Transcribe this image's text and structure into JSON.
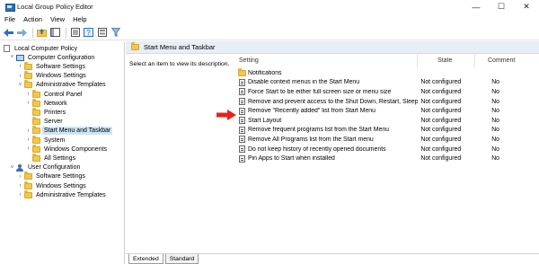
{
  "window": {
    "title": "Local Group Policy Editor",
    "controls": [
      "—",
      "☐",
      "✕"
    ]
  },
  "menu": [
    "File",
    "Action",
    "View",
    "Help"
  ],
  "toolbar": [
    "back-icon",
    "forward-icon",
    "up-folder-icon",
    "show-hide-tree-icon",
    "export-list-icon",
    "help-icon",
    "properties-icon",
    "filter-icon"
  ],
  "tree": [
    {
      "label": "Local Computer Policy",
      "icon": "doc",
      "indent": 0,
      "exp": ""
    },
    {
      "label": "Computer Configuration",
      "icon": "computer",
      "indent": 1,
      "exp": "v"
    },
    {
      "label": "Software Settings",
      "icon": "folder",
      "indent": 2,
      "exp": ">"
    },
    {
      "label": "Windows Settings",
      "icon": "folder",
      "indent": 2,
      "exp": ">"
    },
    {
      "label": "Administrative Templates",
      "icon": "folder",
      "indent": 2,
      "exp": "v"
    },
    {
      "label": "Control Panel",
      "icon": "folder",
      "indent": 3,
      "exp": ">"
    },
    {
      "label": "Network",
      "icon": "folder",
      "indent": 3,
      "exp": ">"
    },
    {
      "label": "Printers",
      "icon": "folder",
      "indent": 3,
      "exp": ""
    },
    {
      "label": "Server",
      "icon": "folder",
      "indent": 3,
      "exp": ""
    },
    {
      "label": "Start Menu and Taskbar",
      "icon": "folder",
      "indent": 3,
      "exp": ">",
      "selected": true
    },
    {
      "label": "System",
      "icon": "folder",
      "indent": 3,
      "exp": ">"
    },
    {
      "label": "Windows Components",
      "icon": "folder",
      "indent": 3,
      "exp": ">"
    },
    {
      "label": "All Settings",
      "icon": "folder",
      "indent": 3,
      "exp": ""
    },
    {
      "label": "User Configuration",
      "icon": "user",
      "indent": 1,
      "exp": "v"
    },
    {
      "label": "Software Settings",
      "icon": "folder",
      "indent": 2,
      "exp": ">"
    },
    {
      "label": "Windows Settings",
      "icon": "folder",
      "indent": 2,
      "exp": ">"
    },
    {
      "label": "Administrative Templates",
      "icon": "folder",
      "indent": 2,
      "exp": ">"
    }
  ],
  "details": {
    "header": "Start Menu and Taskbar",
    "description": "Select an item to view its description.",
    "columns": {
      "setting": "Setting",
      "state": "State",
      "comment": "Comment"
    },
    "rows": [
      {
        "icon": "folder",
        "name": "Notifications",
        "state": "",
        "comment": ""
      },
      {
        "icon": "policy",
        "name": "Disable context menus in the Start Menu",
        "state": "Not configured",
        "comment": "No"
      },
      {
        "icon": "policy",
        "name": "Force Start to be either full screen size or menu size",
        "state": "Not configured",
        "comment": "No"
      },
      {
        "icon": "policy",
        "name": "Remove and prevent access to the Shut Down, Restart, Sleep...",
        "state": "Not configured",
        "comment": "No"
      },
      {
        "icon": "policy",
        "name": "Remove \"Recently added\" list from Start Menu",
        "state": "Not configured",
        "comment": "No"
      },
      {
        "icon": "policy",
        "name": "Start Layout",
        "state": "Not configured",
        "comment": "No"
      },
      {
        "icon": "policy",
        "name": "Remove frequent programs list from the Start Menu",
        "state": "Not configured",
        "comment": "No"
      },
      {
        "icon": "policy",
        "name": "Remove All Programs list from the Start menu",
        "state": "Not configured",
        "comment": "No"
      },
      {
        "icon": "policy",
        "name": "Do not keep history of recently opened documents",
        "state": "Not configured",
        "comment": "No"
      },
      {
        "icon": "policy",
        "name": "Pin Apps to Start when installed",
        "state": "Not configured",
        "comment": "No"
      }
    ]
  },
  "tabs": [
    "Extended",
    "Standard"
  ],
  "colors": {
    "arrow": "#e8201f",
    "selection": "#cde3f7",
    "header": "#e8eef6"
  }
}
